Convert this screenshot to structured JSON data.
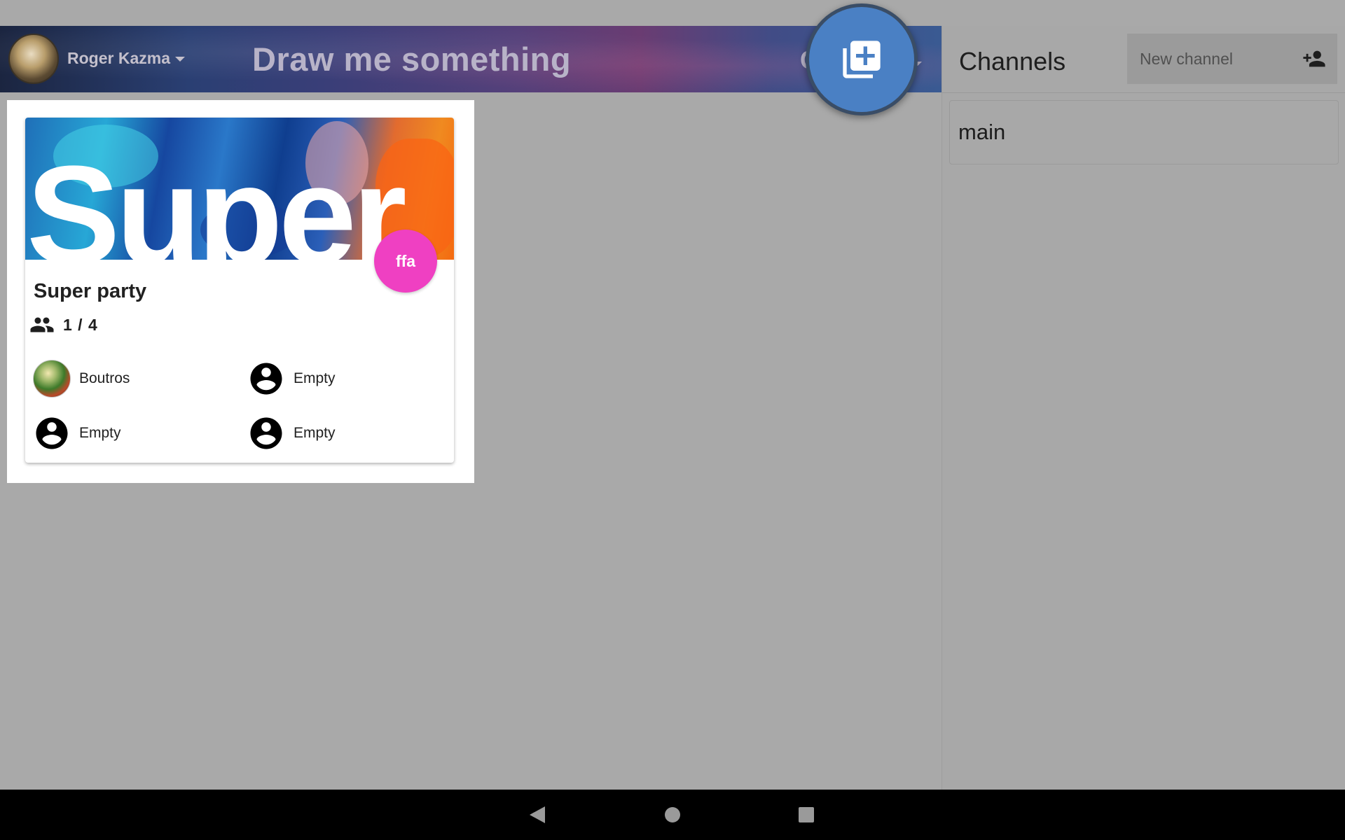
{
  "header": {
    "user_name": "Roger Kazma",
    "app_title": "Draw me something",
    "partial_label": "C"
  },
  "fab": {
    "icon": "add-to-library-icon"
  },
  "channels": {
    "title": "Channels",
    "new_channel_placeholder": "New channel",
    "add_icon": "group-add-icon",
    "items": [
      {
        "label": "main"
      }
    ]
  },
  "games": [
    {
      "banner_text": "Super",
      "mode": "ffa",
      "title": "Super party",
      "players_icon": "people-icon",
      "player_count": "1 / 4",
      "slots": [
        {
          "name": "Boutros",
          "avatar": "photo"
        },
        {
          "name": "Empty",
          "avatar": "account-circle-icon"
        },
        {
          "name": "Empty",
          "avatar": "account-circle-icon"
        },
        {
          "name": "Empty",
          "avatar": "account-circle-icon"
        }
      ]
    }
  ],
  "nav": {
    "back": "back-triangle-icon",
    "home": "home-circle-icon",
    "recents": "recents-square-icon"
  },
  "colors": {
    "fab": "#4a80c4",
    "mode_badge": "#ef40c2",
    "background": "#a9a9a9"
  }
}
